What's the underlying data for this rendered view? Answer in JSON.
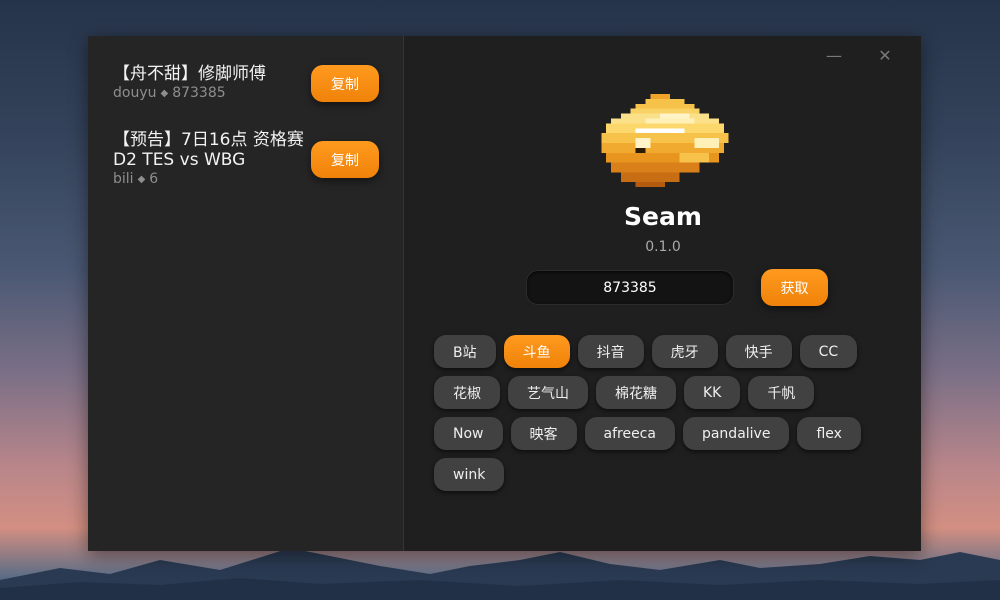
{
  "history": [
    {
      "title": "【舟不甜】修脚师傅",
      "platform": "douyu",
      "room": "873385",
      "sep": "◆",
      "copy_label": "复制"
    },
    {
      "title": "【预告】7日16点 资格赛\nD2 TES vs WBG",
      "platform": "bili",
      "room": "6",
      "sep": "◆",
      "copy_label": "复制"
    }
  ],
  "window_controls": {
    "minimize": "—",
    "close": "✕"
  },
  "app": {
    "name": "Seam",
    "version": "0.1.0"
  },
  "room_input": {
    "value": "873385"
  },
  "fetch_label": "获取",
  "platforms": [
    "B站",
    "斗鱼",
    "抖音",
    "虎牙",
    "快手",
    "CC",
    "花椒",
    "艺气山",
    "棉花糖",
    "KK",
    "千帆",
    "Now",
    "映客",
    "afreeca",
    "pandalive",
    "flex",
    "wink"
  ],
  "selected_platform": "斗鱼",
  "colors": {
    "accent": "#ff8c12",
    "panel": "#252525",
    "background": "#1f1f1f",
    "chip": "#414141"
  }
}
